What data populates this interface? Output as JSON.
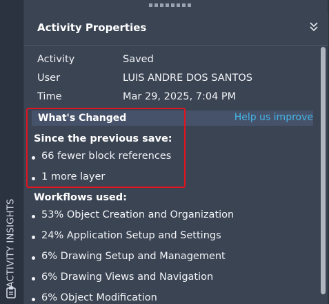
{
  "side_tab": {
    "label": "ACTIVITY INSIGHTS"
  },
  "panel": {
    "title": "Activity Properties",
    "properties": [
      {
        "label": "Activity",
        "value": "Saved"
      },
      {
        "label": "User",
        "value": "LUIS ANDRE DOS SANTOS"
      },
      {
        "label": "Time",
        "value": "Mar 29, 2025, 7:04 PM"
      }
    ],
    "whats_changed": {
      "title": "What's Changed",
      "help_link": "Help us improve",
      "since_label": "Since the previous save:",
      "items": [
        "66 fewer block references",
        "1 more layer"
      ]
    },
    "workflows": {
      "label": "Workflows used:",
      "items": [
        "53% Object Creation and Organization",
        "24% Application Setup and Settings",
        "6% Drawing Setup and Management",
        "6% Drawing Views and Navigation",
        "6% Object Modification"
      ]
    }
  },
  "colors": {
    "accent_link": "#45b5e8",
    "highlight_border": "#e2141e",
    "panel_bg": "#3b4453"
  },
  "icons": {
    "collapse": "double-chevron-down-icon",
    "side": "clipboard-icon"
  }
}
